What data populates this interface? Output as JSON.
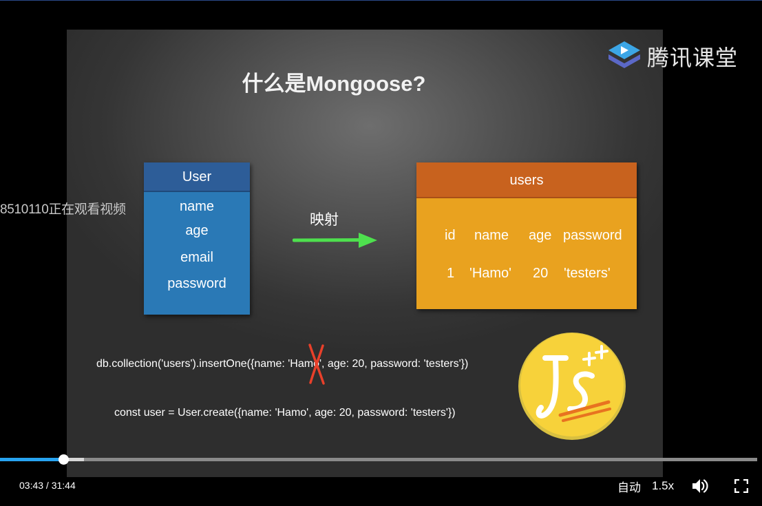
{
  "slide": {
    "title": "什么是Mongoose?",
    "brand": "腾讯课堂",
    "model": {
      "header": "User",
      "fields": [
        "name",
        "age",
        "email",
        "password"
      ]
    },
    "mapping_label": "映射",
    "collection": {
      "header": "users",
      "columns": [
        "id",
        "name",
        "age",
        "password"
      ],
      "row": [
        "1",
        "'Hamo'",
        "20",
        "'testers'"
      ]
    },
    "code": {
      "insert": "db.collection('users').insertOne({name: 'Hamo', age: 20, password: 'testers'})",
      "create": "const user = User.create({name: 'Hamo', age: 20, password: 'testers'})"
    },
    "colors": {
      "model_header": "#2d5d98",
      "model_body": "#2a79b6",
      "collection_header": "#c8621e",
      "collection_body": "#e9a21f",
      "arrow": "#4ee04e",
      "cross": "#e8402a"
    }
  },
  "overlay": {
    "viewer_text": "8510110正在观看视频"
  },
  "player": {
    "time_current": "03:43",
    "time_total": "31:44",
    "time_display": "03:43 / 31:44",
    "played_fraction": 0.084,
    "buffered_fraction": 0.111,
    "quality_label": "自动",
    "speed_label": "1.5x",
    "volume_icon": "volume-icon",
    "fullscreen_icon": "fullscreen-icon",
    "accent_color": "#27a3f0"
  }
}
